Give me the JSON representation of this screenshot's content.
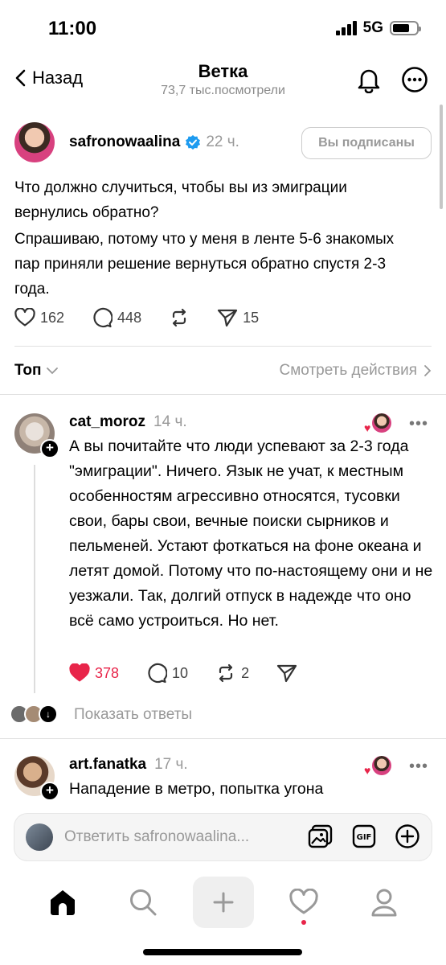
{
  "status_bar": {
    "time": "11:00",
    "network": "5G",
    "battery_level": 0.7
  },
  "header": {
    "back_label": "Назад",
    "title": "Ветка",
    "subtitle": "73,7 тыс.посмотрели"
  },
  "post": {
    "username": "safronowaalina",
    "verified": true,
    "time": "22 ч.",
    "follow_label": "Вы подписаны",
    "text_line1": "Что должно случиться, чтобы вы из эмиграции вернулись обратно?",
    "text_line2": "Спрашиваю, потому что у меня в ленте 5-6 знакомых пар приняли решение вернуться обратно спустя 2-3 года.",
    "likes": "162",
    "comments": "448",
    "shares": "15"
  },
  "sort": {
    "label": "Топ",
    "view_actions": "Смотреть действия"
  },
  "comments": [
    {
      "username": "cat_moroz",
      "time": "14 ч.",
      "text": "А вы почитайте что люди успевают за 2-3 года \"эмиграции\". Ничего. Язык не учат, к местным особенностям агрессивно относятся, тусовки свои, бары свои, вечные поиски сырников и пельменей. Устают фоткаться на фоне океана и летят домой. Потому что по-настоящему они и не уезжали. Так, долгий отпуск в надежде что оно всё само устроиться. Но нет.",
      "likes": "378",
      "replies": "10",
      "reposts": "2",
      "liked": true
    },
    {
      "username": "art.fanatka",
      "time": "17 ч.",
      "text": "Нападение в метро, попытка угона"
    }
  ],
  "show_replies_label": "Показать ответы",
  "reply_placeholder": "Ответить safronowaalina...",
  "colors": {
    "accent_red": "#e8254a",
    "verified_blue": "#1d9bf0",
    "muted": "#999999"
  },
  "icons": [
    "back-chevron-icon",
    "bell-icon",
    "more-icon",
    "heart-icon",
    "comment-icon",
    "repost-icon",
    "share-icon",
    "image-icon",
    "gif-icon",
    "plus-circle-icon",
    "home-icon",
    "search-icon",
    "create-icon",
    "activity-icon",
    "profile-icon"
  ]
}
